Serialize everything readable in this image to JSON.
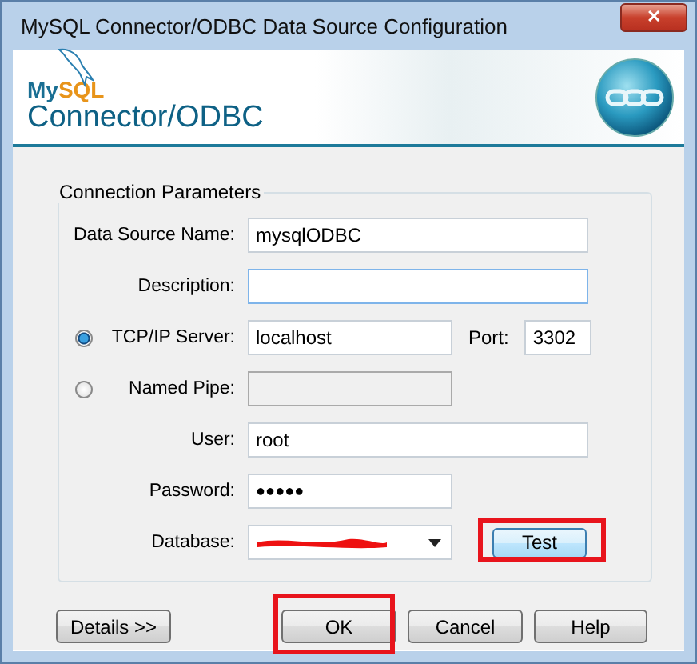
{
  "window": {
    "title": "MySQL Connector/ODBC Data Source Configuration",
    "close_glyph": "✕"
  },
  "header": {
    "logo_a": "My",
    "logo_b": "SQL",
    "product": "Connector/ODBC"
  },
  "group": {
    "title": "Connection Parameters",
    "rows": [
      {
        "kind": "text",
        "label": "Data Source Name:",
        "value": "mysqlODBC",
        "disabled": false,
        "focused": false
      },
      {
        "kind": "text",
        "label": "Description:",
        "disabled": false,
        "focused": true
      },
      {
        "kind": "radio",
        "label": "TCP/IP Server:",
        "value": "localhost",
        "selected": true,
        "disabled": false,
        "focused": false,
        "port_label": "Port:",
        "port": "3302"
      },
      {
        "kind": "radio",
        "label": "Named Pipe:",
        "selected": false,
        "disabled": true,
        "focused": false
      },
      {
        "kind": "text",
        "label": "User:",
        "value": "root",
        "disabled": false,
        "focused": false
      },
      {
        "kind": "password",
        "label": "Password:",
        "value": "●●●●●",
        "disabled": false,
        "focused": false
      },
      {
        "kind": "dropdown",
        "label": "Database:",
        "redacted": true,
        "disabled": false,
        "focused": false,
        "button": {
          "label": "Test",
          "highlighted": true
        }
      }
    ]
  },
  "buttons": [
    {
      "label": "Details >>",
      "highlighted": false
    },
    {
      "label": "OK",
      "highlighted": true
    },
    {
      "label": "Cancel",
      "highlighted": false
    },
    {
      "label": "Help",
      "highlighted": false
    }
  ]
}
